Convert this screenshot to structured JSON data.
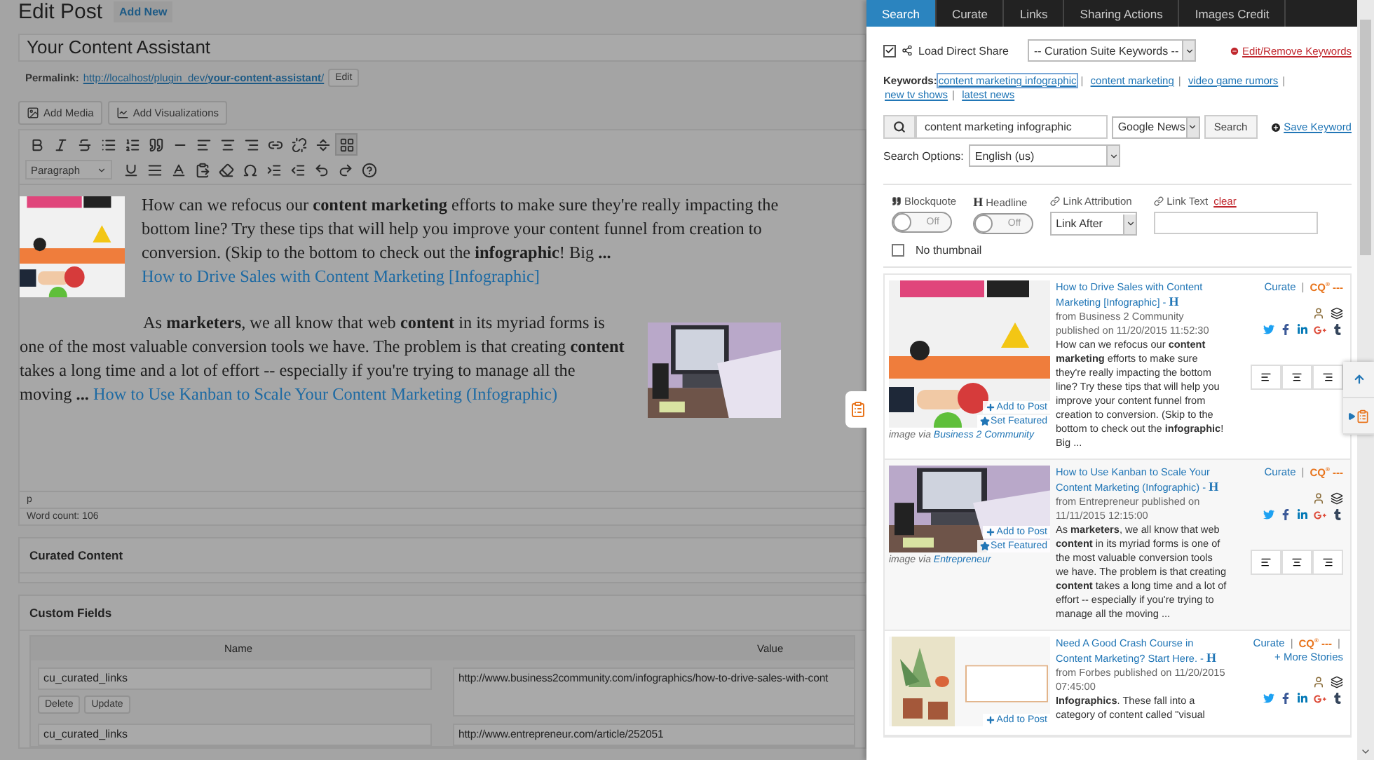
{
  "page": {
    "title": "Edit Post",
    "add_new": "Add New"
  },
  "post_title": "Your Content Assistant",
  "permalink": {
    "label": "Permalink:",
    "url_base": "http://localhost/plugin_dev/",
    "slug": "your-content-assistant",
    "suffix": "/",
    "edit": "Edit"
  },
  "media_buttons": [
    "Add Media",
    "Add Visualizations"
  ],
  "editor": {
    "format": "Paragraph",
    "toolbar_toggle_selected": true,
    "paragraphs": [
      {
        "text": "How can we refocus our **content marketing** efforts to make sure they're really impacting the bottom line? Try these tips that will help you improve your content funnel from creation to conversion. (Skip to the bottom to check out the **infographic**! Big **...**",
        "link": "How to Drive Sales with Content Marketing [Infographic]"
      },
      {
        "text": "As **marketers**, we all know that web **content** in its myriad forms is one of the most valuable conversion tools we have. The problem is that creating **content** takes a long time and a lot of effort -- especially if you're trying to manage all the moving **...**",
        "link": "How to Use Kanban to Scale Your Content Marketing (Infographic)"
      }
    ],
    "path": "p",
    "word_count": "Word count: 106"
  },
  "curated_content": {
    "title": "Curated Content"
  },
  "custom_fields": {
    "title": "Custom Fields",
    "columns": [
      "Name",
      "Value"
    ],
    "rows": [
      {
        "name": "cu_curated_links",
        "value": "http://www.business2community.com/infographics/how-to-drive-sales-with-cont",
        "buttons": [
          "Delete",
          "Update"
        ]
      },
      {
        "name": "cu_curated_links",
        "value": "http://www.entrepreneur.com/article/252051"
      }
    ]
  },
  "panel": {
    "tabs": [
      {
        "label": "Search",
        "selected": true
      },
      {
        "label": "Curate",
        "selected": false
      },
      {
        "label": "Links",
        "selected": false
      },
      {
        "label": "Sharing Actions",
        "selected": false
      },
      {
        "label": "Images Credit",
        "selected": false
      }
    ],
    "load_direct_share": {
      "label": "Load Direct Share",
      "checked": true
    },
    "keywords_select": "-- Curation Suite Keywords --",
    "edit_keywords": "Edit/Remove Keywords",
    "keywords_label": "Keywords:",
    "separator": "|",
    "keywords": [
      {
        "label": "content marketing infographic",
        "selected": true
      },
      {
        "label": "content marketing",
        "selected": false
      },
      {
        "label": "video game rumors",
        "selected": false
      },
      {
        "label": "new tv shows",
        "selected": false
      },
      {
        "label": "latest news",
        "selected": false
      }
    ],
    "search": {
      "value": "content marketing infographic",
      "source": "Google News",
      "button": "Search",
      "save": "Save Keyword"
    },
    "search_options": {
      "label": "Search Options:",
      "value": "English (us)"
    },
    "options": [
      {
        "kind": "toggle",
        "label": "Blockquote",
        "state": "Off",
        "on": false
      },
      {
        "kind": "toggle",
        "glyph": "H",
        "label": "Headline",
        "state": "Off",
        "on": false
      },
      {
        "kind": "select",
        "label": "Link Attribution",
        "value": "Link After"
      },
      {
        "kind": "text",
        "label": "Link Text",
        "clear": "clear"
      }
    ],
    "no_thumbnail": {
      "label": "No thumbnail",
      "checked": false
    },
    "stories": [
      {
        "title": "How to Drive Sales with Content Marketing [Infographic] -",
        "headline_mark": "H",
        "source": "from Business 2 Community published on 11/20/2015 11:52:30",
        "excerpt": "How can we refocus our **content marketing** efforts to make sure they're really impacting the bottom line? Try these tips that will help you improve your content funnel from creation to conversion. (Skip to the bottom to check out the **infographic**! Big ...",
        "add_to_post": "Add to Post",
        "set_featured": "Set Featured",
        "credit_label": "image via",
        "credit_source": "Business 2 Community",
        "curate": "Curate",
        "cq": "CQ$^{®}$ ---"
      },
      {
        "title": "How to Use Kanban to Scale Your Content Marketing (Infographic) -",
        "headline_mark": "H",
        "source": "from Entrepreneur published on 11/11/2015 12:15:00",
        "excerpt": "As **marketers**, we all know that web **content** in its myriad forms is one of the most valuable conversion tools we have. The problem is that creating **content** takes a long time and a lot of effort -- especially if you're trying to manage all the moving ...",
        "add_to_post": "Add to Post",
        "set_featured": "Set Featured",
        "credit_label": "image via",
        "credit_source": "Entrepreneur",
        "curate": "Curate",
        "cq": "CQ$^{®}$ ---"
      },
      {
        "title": "Need A Good Crash Course in Content Marketing? Start Here. -",
        "headline_mark": "H",
        "source": "from Forbes published on 11/20/2015 07:45:00",
        "excerpt": "**Infographics**. These fall into a category of content called \"visual",
        "add_to_post": "Add to Post",
        "curate": "Curate",
        "cq": "CQ$^{®}$ ---",
        "more": "+ More Stories"
      }
    ]
  }
}
